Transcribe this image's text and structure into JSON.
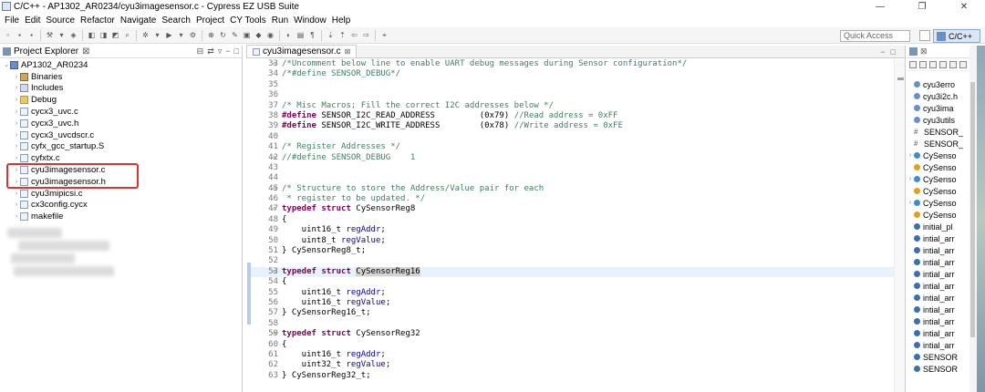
{
  "window": {
    "title": "C/C++ - AP1302_AR0234/cyu3imagesensor.c - Cypress EZ USB Suite",
    "controls": [
      "—",
      "❐",
      "✕"
    ]
  },
  "menu": [
    "File",
    "Edit",
    "Source",
    "Refactor",
    "Navigate",
    "Search",
    "Project",
    "CY Tools",
    "Run",
    "Window",
    "Help"
  ],
  "toolbar": {
    "quick_access": "Quick Access",
    "perspective": "C/C++"
  },
  "project_explorer": {
    "title": "Project Explorer",
    "tab_close": "⊠",
    "items": [
      {
        "label": "AP1302_AR0234",
        "depth": 0,
        "icon": "project-icon",
        "expanded": true
      },
      {
        "label": "Binaries",
        "depth": 1,
        "icon": "binaries-icon"
      },
      {
        "label": "Includes",
        "depth": 1,
        "icon": "includes-icon"
      },
      {
        "label": "Debug",
        "depth": 1,
        "icon": "folder-icon"
      },
      {
        "label": "cycx3_uvc.c",
        "depth": 1,
        "icon": "c-file-icon"
      },
      {
        "label": "cycx3_uvc.h",
        "depth": 1,
        "icon": "h-file-icon"
      },
      {
        "label": "cycx3_uvcdscr.c",
        "depth": 1,
        "icon": "c-file-icon"
      },
      {
        "label": "cyfx_gcc_startup.S",
        "depth": 1,
        "icon": "s-file-icon"
      },
      {
        "label": "cyfxtx.c",
        "depth": 1,
        "icon": "c-file-icon"
      },
      {
        "label": "cyu3imagesensor.c",
        "depth": 1,
        "icon": "c-file-icon"
      },
      {
        "label": "cyu3imagesensor.h",
        "depth": 1,
        "icon": "h-file-icon"
      },
      {
        "label": "cyu3mipicsi.c",
        "depth": 1,
        "icon": "c-file-icon"
      },
      {
        "label": "cx3config.cycx",
        "depth": 1,
        "icon": "config-file-icon"
      },
      {
        "label": "makefile",
        "depth": 1,
        "icon": "makefile-icon"
      }
    ]
  },
  "editor": {
    "tab_label": "cyu3imagesensor.c",
    "tab_close": "⊠",
    "lines": [
      {
        "n": "33",
        "fold": "⊖",
        "text": "/*Uncomment below line to enable UART debug messages during Sensor configuration*/",
        "kind": "comment"
      },
      {
        "n": "34",
        "text": "/*#define SENSOR_DEBUG*/",
        "kind": "comment"
      },
      {
        "n": "35",
        "text": "",
        "kind": "plain"
      },
      {
        "n": "36",
        "text": "",
        "kind": "plain"
      },
      {
        "n": "37",
        "text": "/* Misc Macros; Fill the correct I2C addresses below */",
        "kind": "comment"
      },
      {
        "n": "38",
        "kw": "#define",
        "text": " SENSOR_I2C_READ_ADDRESS         (0x79) ",
        "tail": "//Read address = 0xFF",
        "kind": "define"
      },
      {
        "n": "39",
        "kw": "#define",
        "text": " SENSOR_I2C_WRITE_ADDRESS        (0x78) ",
        "tail": "//Write address = 0xFE",
        "kind": "define"
      },
      {
        "n": "40",
        "text": "",
        "kind": "plain"
      },
      {
        "n": "41",
        "text": "/* Register Addresses */",
        "kind": "comment"
      },
      {
        "n": "42",
        "fold": "⊖",
        "text": "//#define SENSOR_DEBUG    1",
        "kind": "comment"
      },
      {
        "n": "43",
        "text": "",
        "kind": "plain"
      },
      {
        "n": "44",
        "text": "",
        "kind": "plain"
      },
      {
        "n": "45",
        "fold": "⊖",
        "text": "/* Structure to store the Address/Value pair for each",
        "kind": "comment"
      },
      {
        "n": "46",
        "text": " * register to be updated. */",
        "kind": "comment"
      },
      {
        "n": "47",
        "fold": "⊖",
        "kw": "typedef struct",
        "text": " CySensorReg8",
        "kind": "typedef"
      },
      {
        "n": "48",
        "text": "{",
        "kind": "plain"
      },
      {
        "n": "49",
        "text": "    uint16_t ",
        "field": "regAddr",
        "tail2": ";",
        "kind": "field"
      },
      {
        "n": "50",
        "text": "    uint8_t ",
        "field": "regValue",
        "tail2": ";",
        "kind": "field"
      },
      {
        "n": "51",
        "text": "} CySensorReg8_t;",
        "kind": "plain"
      },
      {
        "n": "52",
        "text": "",
        "kind": "plain"
      },
      {
        "n": "53",
        "fold": "⊖",
        "kw": "typedef struct",
        "text": " ",
        "sel": "CySensorReg16",
        "kind": "typedef-sel",
        "current": true
      },
      {
        "n": "54",
        "text": "{",
        "kind": "plain"
      },
      {
        "n": "55",
        "text": "    uint16_t ",
        "field": "regAddr",
        "tail2": ";",
        "kind": "field"
      },
      {
        "n": "56",
        "text": "    uint16_t ",
        "field": "regValue",
        "tail2": ";",
        "kind": "field"
      },
      {
        "n": "57",
        "text": "} CySensorReg16_t;",
        "kind": "plain"
      },
      {
        "n": "58",
        "text": "",
        "kind": "plain"
      },
      {
        "n": "59",
        "fold": "⊖",
        "kw": "typedef struct",
        "text": " CySensorReg32",
        "kind": "typedef"
      },
      {
        "n": "60",
        "text": "{",
        "kind": "plain"
      },
      {
        "n": "61",
        "text": "    uint16_t ",
        "field": "regAddr",
        "tail2": ";",
        "kind": "field"
      },
      {
        "n": "62",
        "text": "    uint32_t ",
        "field": "regValue",
        "tail2": ";",
        "kind": "field"
      },
      {
        "n": "63",
        "text": "} CySensorReg32_t;",
        "kind": "plain"
      }
    ]
  },
  "outline": {
    "items": [
      {
        "label": "cyu3erro",
        "icon": "include-icon",
        "color": "#6a8fc4"
      },
      {
        "label": "cyu3i2c.h",
        "icon": "include-icon",
        "color": "#6a8fc4"
      },
      {
        "label": "cyu3ima",
        "icon": "include-icon",
        "color": "#6a8fc4"
      },
      {
        "label": "cyu3utils",
        "icon": "include-icon",
        "color": "#6a8fc4"
      },
      {
        "label": "SENSOR_",
        "icon": "macro-icon",
        "color": "#555555",
        "glyph": "#"
      },
      {
        "label": "SENSOR_",
        "icon": "macro-icon",
        "color": "#555555",
        "glyph": "#"
      },
      {
        "label": "CySenso",
        "icon": "struct-icon",
        "color": "#3a8fd0",
        "twisty": "›"
      },
      {
        "label": "CySenso",
        "icon": "typedef-icon",
        "color": "#e0a020"
      },
      {
        "label": "CySenso",
        "icon": "struct-icon",
        "color": "#3a8fd0",
        "twisty": "›"
      },
      {
        "label": "CySenso",
        "icon": "typedef-icon",
        "color": "#e0a020"
      },
      {
        "label": "CySenso",
        "icon": "struct-icon",
        "color": "#3a8fd0",
        "twisty": "›"
      },
      {
        "label": "CySenso",
        "icon": "typedef-icon",
        "color": "#e0a020"
      },
      {
        "label": "initial_pl",
        "icon": "variable-icon",
        "color": "#3a6fb0"
      },
      {
        "label": "intial_arr",
        "icon": "variable-icon",
        "color": "#3a6fb0"
      },
      {
        "label": "intial_arr",
        "icon": "variable-icon",
        "color": "#3a6fb0"
      },
      {
        "label": "intial_arr",
        "icon": "variable-icon",
        "color": "#3a6fb0"
      },
      {
        "label": "intial_arr",
        "icon": "variable-icon",
        "color": "#3a6fb0"
      },
      {
        "label": "intial_arr",
        "icon": "variable-icon",
        "color": "#3a6fb0"
      },
      {
        "label": "intial_arr",
        "icon": "const-variable-icon",
        "color": "#3a6fb0"
      },
      {
        "label": "intial_arr",
        "icon": "const-variable-icon",
        "color": "#3a6fb0"
      },
      {
        "label": "intial_arr",
        "icon": "const-variable-icon",
        "color": "#3a6fb0"
      },
      {
        "label": "intial_arr",
        "icon": "variable-icon",
        "color": "#3a6fb0"
      },
      {
        "label": "intial_arr",
        "icon": "variable-icon",
        "color": "#3a6fb0"
      },
      {
        "label": "SENSOR",
        "icon": "variable-icon",
        "color": "#3a6fb0"
      },
      {
        "label": "SENSOR",
        "icon": "variable-icon",
        "color": "#3a6fb0"
      }
    ]
  }
}
